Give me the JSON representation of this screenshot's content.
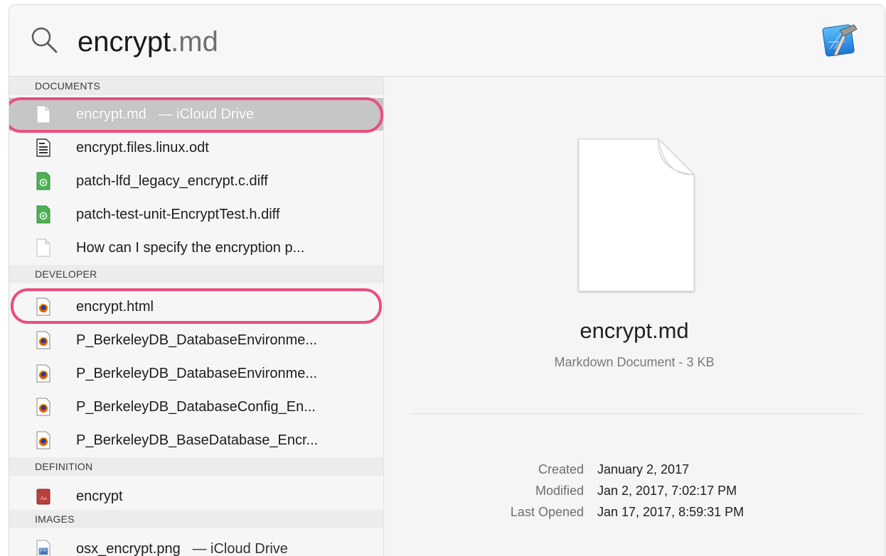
{
  "search": {
    "typed": "encrypt",
    "completion": ".md"
  },
  "sections": [
    {
      "header": "DOCUMENTS",
      "items": [
        {
          "label": "encrypt.md",
          "sub": "— iCloud Drive",
          "icon": "blank-document-icon",
          "selected": true,
          "highlighted": true
        },
        {
          "label": "encrypt.files.linux.odt",
          "icon": "text-document-icon"
        },
        {
          "label": "patch-lfd_legacy_encrypt.c.diff",
          "icon": "diff-file-icon"
        },
        {
          "label": "patch-test-unit-EncryptTest.h.diff",
          "icon": "diff-file-icon"
        },
        {
          "label": "How can I specify the encryption p...",
          "icon": "blank-document-icon"
        }
      ]
    },
    {
      "header": "DEVELOPER",
      "items": [
        {
          "label": "encrypt.html",
          "icon": "firefox-document-icon",
          "highlighted": true
        },
        {
          "label": "P_BerkeleyDB_DatabaseEnvironme...",
          "icon": "firefox-document-icon"
        },
        {
          "label": "P_BerkeleyDB_DatabaseEnvironme...",
          "icon": "firefox-document-icon"
        },
        {
          "label": "P_BerkeleyDB_DatabaseConfig_En...",
          "icon": "firefox-document-icon"
        },
        {
          "label": "P_BerkeleyDB_BaseDatabase_Encr...",
          "icon": "firefox-document-icon"
        }
      ]
    },
    {
      "header": "DEFINITION",
      "items": [
        {
          "label": "encrypt",
          "icon": "dictionary-icon"
        }
      ]
    },
    {
      "header": "IMAGES",
      "items": [
        {
          "label": "osx_encrypt.png",
          "sub": "— iCloud Drive",
          "icon": "png-image-icon"
        }
      ]
    }
  ],
  "preview": {
    "name": "encrypt.md",
    "kind": "Markdown Document - 3 KB",
    "meta": [
      {
        "key": "Created",
        "value": "January 2, 2017"
      },
      {
        "key": "Modified",
        "value": "Jan 2, 2017, 7:02:17 PM"
      },
      {
        "key": "Last Opened",
        "value": "Jan 17, 2017, 8:59:31 PM"
      }
    ]
  },
  "colors": {
    "highlight_ring": "#ea4f7c",
    "selected_row": "#c6c6c6"
  },
  "icons": {
    "search": "magnifier-icon",
    "app": "xcode-app-icon",
    "preview": "blank-document-icon"
  }
}
